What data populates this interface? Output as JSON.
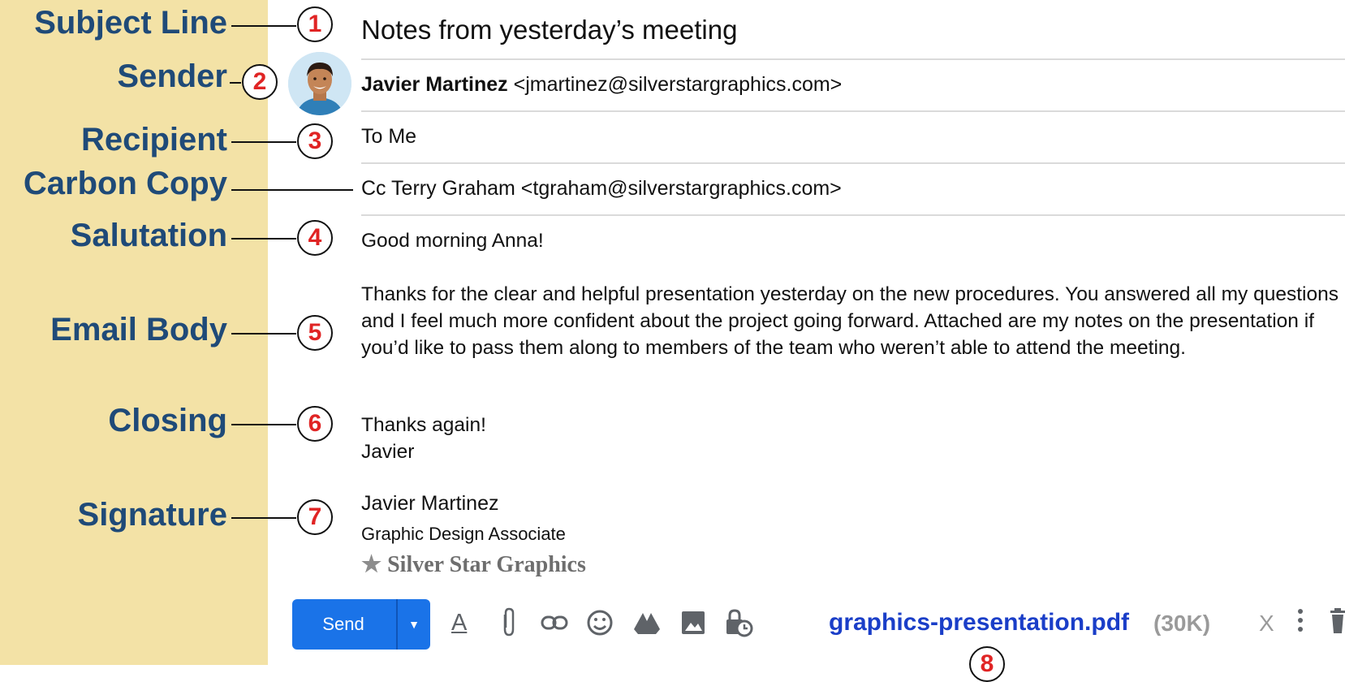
{
  "annotations": {
    "subject": "Subject Line",
    "sender": "Sender",
    "recipient": "Recipient",
    "cc": "Carbon Copy",
    "salutation": "Salutation",
    "body": "Email Body",
    "closing": "Closing",
    "signature": "Signature"
  },
  "markers": [
    "1",
    "2",
    "3",
    "4",
    "5",
    "6",
    "7",
    "8"
  ],
  "email": {
    "subject": "Notes from yesterday’s meeting",
    "sender_name": "Javier Martinez",
    "sender_email": "<jmartinez@silverstargraphics.com>",
    "recipient": "To Me",
    "cc": "Cc Terry Graham <tgraham@silverstargraphics.com>",
    "salutation": "Good morning Anna!",
    "body": "Thanks for the clear and helpful presentation yesterday on the new procedures. You answered all my questions and I feel much more confident about the project going forward. Attached are my notes on the presentation if you’d like to pass them along to members of the team who weren’t able to attend the meeting.",
    "closing_line1": "Thanks again!",
    "closing_line2": "Javier",
    "signature_name": "Javier Martinez",
    "signature_title": "Graphic Design Associate",
    "signature_company": "Silver Star Graphics"
  },
  "toolbar": {
    "send_label": "Send",
    "attachment_name": "graphics-presentation.pdf",
    "attachment_size": "(30K)",
    "remove_label": "X"
  },
  "colors": {
    "sidebar_bg": "#f3e2a6",
    "label_color": "#1f4a78",
    "marker_color": "#e02424",
    "send_button": "#1a73e8",
    "attachment_link": "#1a3ec8"
  },
  "icons": [
    "format-text-icon",
    "paperclip-icon",
    "link-icon",
    "emoji-icon",
    "drive-icon",
    "image-icon",
    "lock-clock-icon",
    "more-vert-icon",
    "trash-icon",
    "star-icon"
  ]
}
